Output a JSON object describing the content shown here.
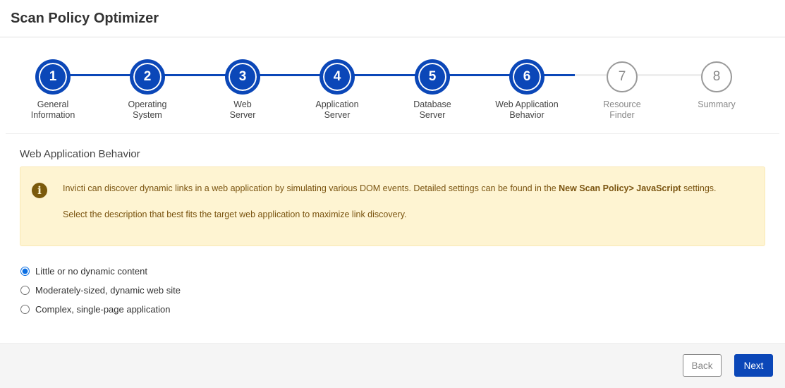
{
  "header": {
    "title": "Scan Policy Optimizer"
  },
  "stepper": {
    "current_step": 6,
    "steps": [
      {
        "number": "1",
        "label_line1": "General",
        "label_line2": "Information",
        "state": "done"
      },
      {
        "number": "2",
        "label_line1": "Operating",
        "label_line2": "System",
        "state": "done"
      },
      {
        "number": "3",
        "label_line1": "Web",
        "label_line2": "Server",
        "state": "done"
      },
      {
        "number": "4",
        "label_line1": "Application",
        "label_line2": "Server",
        "state": "done"
      },
      {
        "number": "5",
        "label_line1": "Database",
        "label_line2": "Server",
        "state": "done"
      },
      {
        "number": "6",
        "label_line1": "Web Application",
        "label_line2": "Behavior",
        "state": "current"
      },
      {
        "number": "7",
        "label_line1": "Resource",
        "label_line2": "Finder",
        "state": "pending"
      },
      {
        "number": "8",
        "label_line1": "Summary",
        "label_line2": "",
        "state": "pending"
      }
    ]
  },
  "content": {
    "section_title": "Web Application Behavior",
    "alert": {
      "icon": "info-icon",
      "text_before": "Invicti can discover dynamic links in a web application by simulating various DOM events. Detailed settings can be found in the ",
      "text_bold": "New Scan Policy> JavaScript",
      "text_after": " settings.",
      "text_second": "Select the description that best fits the target web application to maximize link discovery."
    },
    "options": [
      {
        "label": "Little or no dynamic content",
        "checked": true
      },
      {
        "label": "Moderately-sized, dynamic web site",
        "checked": false
      },
      {
        "label": "Complex, single-page application",
        "checked": false
      }
    ]
  },
  "footer": {
    "back_label": "Back",
    "next_label": "Next"
  },
  "colors": {
    "primary": "#0b47b8",
    "alert_bg": "#fef4d2",
    "alert_text": "#7a5410"
  }
}
